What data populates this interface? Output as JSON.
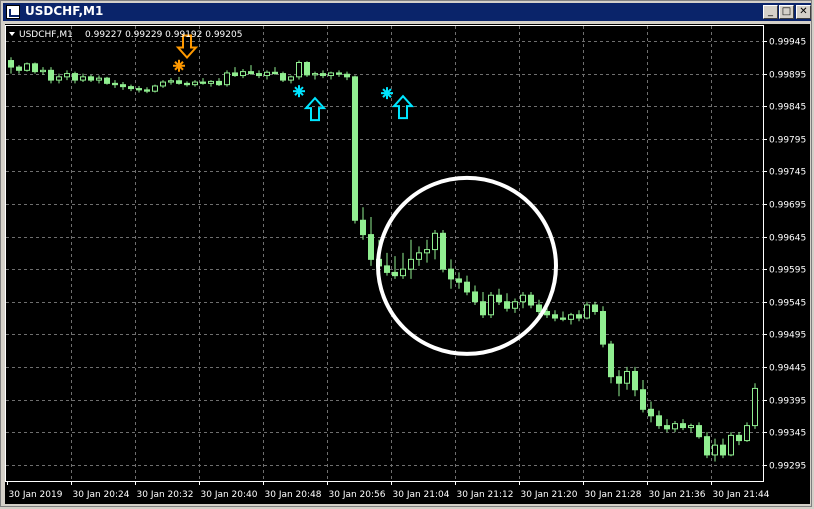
{
  "window": {
    "title": "USDCHF,M1",
    "minimize_glyph": "_",
    "maximize_glyph": "□",
    "close_glyph": "✕"
  },
  "chart_info": {
    "symbol": "USDCHF,M1",
    "ohlc": "0.99227 0.99229 0.99192 0.99205"
  },
  "colors": {
    "background": "#000000",
    "grid": "#6f6f6f",
    "candle": "#90ee90",
    "sell_signal": "#ff9900",
    "buy_signal": "#00e5ff",
    "circle": "#ffffff"
  },
  "chart_data": {
    "type": "candlestick",
    "title": "",
    "xlabel": "",
    "ylabel": "",
    "ylim": [
      0.9927,
      0.99968
    ],
    "grid": true,
    "y_ticks": [
      "0.99945",
      "0.99895",
      "0.99845",
      "0.99795",
      "0.99745",
      "0.99695",
      "0.99645",
      "0.99595",
      "0.99545",
      "0.99495",
      "0.99445",
      "0.99395",
      "0.99345",
      "0.99295"
    ],
    "x_ticks": [
      "30 Jan 2019",
      "30 Jan 20:24",
      "30 Jan 20:32",
      "30 Jan 20:40",
      "30 Jan 20:48",
      "30 Jan 20:56",
      "30 Jan 21:04",
      "30 Jan 21:12",
      "30 Jan 21:20",
      "30 Jan 21:28",
      "30 Jan 21:36",
      "30 Jan 21:44"
    ],
    "candles": [
      [
        0.99915,
        0.9992,
        0.99895,
        0.99905
      ],
      [
        0.99905,
        0.99908,
        0.99895,
        0.999
      ],
      [
        0.999,
        0.99912,
        0.99898,
        0.9991
      ],
      [
        0.9991,
        0.99912,
        0.99895,
        0.99898
      ],
      [
        0.99898,
        0.99905,
        0.99893,
        0.999
      ],
      [
        0.999,
        0.99905,
        0.9988,
        0.99885
      ],
      [
        0.99885,
        0.99895,
        0.9988,
        0.9989
      ],
      [
        0.9989,
        0.999,
        0.99885,
        0.99895
      ],
      [
        0.99895,
        0.99898,
        0.9988,
        0.99885
      ],
      [
        0.99885,
        0.99895,
        0.99882,
        0.9989
      ],
      [
        0.9989,
        0.99893,
        0.99882,
        0.99885
      ],
      [
        0.99885,
        0.99892,
        0.9988,
        0.99888
      ],
      [
        0.99888,
        0.9989,
        0.99878,
        0.9988
      ],
      [
        0.9988,
        0.99885,
        0.99873,
        0.99878
      ],
      [
        0.99878,
        0.99882,
        0.9987,
        0.99875
      ],
      [
        0.99875,
        0.99878,
        0.99868,
        0.99872
      ],
      [
        0.99872,
        0.99876,
        0.99866,
        0.9987
      ],
      [
        0.9987,
        0.99874,
        0.99865,
        0.99868
      ],
      [
        0.99868,
        0.99878,
        0.99866,
        0.99876
      ],
      [
        0.99876,
        0.99885,
        0.99873,
        0.99882
      ],
      [
        0.99882,
        0.99888,
        0.99878,
        0.99884
      ],
      [
        0.99884,
        0.9989,
        0.99878,
        0.9988
      ],
      [
        0.9988,
        0.99883,
        0.99875,
        0.99878
      ],
      [
        0.99878,
        0.99885,
        0.99875,
        0.99882
      ],
      [
        0.99882,
        0.99888,
        0.99878,
        0.9988
      ],
      [
        0.9988,
        0.99885,
        0.99875,
        0.99883
      ],
      [
        0.99883,
        0.99888,
        0.99876,
        0.99878
      ],
      [
        0.99878,
        0.999,
        0.99875,
        0.99896
      ],
      [
        0.99896,
        0.99905,
        0.9989,
        0.99892
      ],
      [
        0.99892,
        0.99902,
        0.99888,
        0.99898
      ],
      [
        0.99898,
        0.99908,
        0.99893,
        0.99895
      ],
      [
        0.99895,
        0.999,
        0.99888,
        0.99892
      ],
      [
        0.99892,
        0.999,
        0.99886,
        0.99897
      ],
      [
        0.99897,
        0.99905,
        0.99893,
        0.99895
      ],
      [
        0.99895,
        0.99898,
        0.99882,
        0.99885
      ],
      [
        0.99885,
        0.99892,
        0.9988,
        0.9989
      ],
      [
        0.9989,
        0.99915,
        0.99886,
        0.99912
      ],
      [
        0.99912,
        0.99914,
        0.9989,
        0.99893
      ],
      [
        0.99893,
        0.99898,
        0.99886,
        0.99895
      ],
      [
        0.99895,
        0.999,
        0.99888,
        0.99892
      ],
      [
        0.99892,
        0.99898,
        0.99886,
        0.99896
      ],
      [
        0.99896,
        0.999,
        0.9989,
        0.99894
      ],
      [
        0.99894,
        0.99898,
        0.99885,
        0.9989
      ],
      [
        0.9989,
        0.99892,
        0.99665,
        0.9967
      ],
      [
        0.9967,
        0.9969,
        0.9964,
        0.99648
      ],
      [
        0.99648,
        0.99675,
        0.996,
        0.9961
      ],
      [
        0.9961,
        0.9964,
        0.99595,
        0.996
      ],
      [
        0.996,
        0.9962,
        0.99585,
        0.9959
      ],
      [
        0.9959,
        0.99615,
        0.9958,
        0.99585
      ],
      [
        0.99585,
        0.9962,
        0.9958,
        0.99595
      ],
      [
        0.99595,
        0.9964,
        0.9958,
        0.9961
      ],
      [
        0.9961,
        0.9963,
        0.996,
        0.9962
      ],
      [
        0.9962,
        0.9964,
        0.99605,
        0.99625
      ],
      [
        0.99625,
        0.99655,
        0.9961,
        0.9965
      ],
      [
        0.9965,
        0.99655,
        0.9959,
        0.99595
      ],
      [
        0.99595,
        0.9961,
        0.99565,
        0.9958
      ],
      [
        0.9958,
        0.9959,
        0.99565,
        0.99575
      ],
      [
        0.99575,
        0.99585,
        0.99555,
        0.9956
      ],
      [
        0.9956,
        0.9957,
        0.9954,
        0.99545
      ],
      [
        0.99545,
        0.9956,
        0.9952,
        0.99525
      ],
      [
        0.99525,
        0.9956,
        0.9952,
        0.99555
      ],
      [
        0.99555,
        0.99565,
        0.9954,
        0.99545
      ],
      [
        0.99545,
        0.99558,
        0.9953,
        0.99535
      ],
      [
        0.99535,
        0.9955,
        0.99528,
        0.99545
      ],
      [
        0.99545,
        0.9956,
        0.99535,
        0.99555
      ],
      [
        0.99555,
        0.9956,
        0.99535,
        0.9954
      ],
      [
        0.9954,
        0.99548,
        0.99525,
        0.9953
      ],
      [
        0.9953,
        0.9954,
        0.9952,
        0.99525
      ],
      [
        0.99525,
        0.99532,
        0.99515,
        0.9952
      ],
      [
        0.9952,
        0.9953,
        0.99515,
        0.99518
      ],
      [
        0.99518,
        0.99528,
        0.9951,
        0.99525
      ],
      [
        0.99525,
        0.99532,
        0.99515,
        0.9952
      ],
      [
        0.9952,
        0.99545,
        0.99518,
        0.9954
      ],
      [
        0.9954,
        0.99545,
        0.99525,
        0.9953
      ],
      [
        0.9953,
        0.99538,
        0.99475,
        0.9948
      ],
      [
        0.9948,
        0.99485,
        0.9942,
        0.9943
      ],
      [
        0.9943,
        0.9944,
        0.994,
        0.9942
      ],
      [
        0.9942,
        0.99445,
        0.9941,
        0.99438
      ],
      [
        0.99438,
        0.99445,
        0.994,
        0.9941
      ],
      [
        0.9941,
        0.99425,
        0.99375,
        0.9938
      ],
      [
        0.9938,
        0.99392,
        0.9936,
        0.9937
      ],
      [
        0.9937,
        0.99378,
        0.9935,
        0.99355
      ],
      [
        0.99355,
        0.99365,
        0.99345,
        0.9935
      ],
      [
        0.9935,
        0.99362,
        0.99345,
        0.99358
      ],
      [
        0.99358,
        0.99365,
        0.99348,
        0.99352
      ],
      [
        0.99352,
        0.99358,
        0.99345,
        0.99355
      ],
      [
        0.99355,
        0.9936,
        0.99335,
        0.99338
      ],
      [
        0.99338,
        0.99345,
        0.99305,
        0.9931
      ],
      [
        0.9931,
        0.99335,
        0.993,
        0.99325
      ],
      [
        0.99325,
        0.99335,
        0.99305,
        0.9931
      ],
      [
        0.9931,
        0.99345,
        0.99308,
        0.9934
      ],
      [
        0.9934,
        0.99345,
        0.99325,
        0.99332
      ],
      [
        0.99332,
        0.9936,
        0.9933,
        0.99355
      ],
      [
        0.99355,
        0.9942,
        0.9935,
        0.99412
      ]
    ],
    "markers": [
      {
        "type": "star",
        "color": "sell_signal",
        "candle": 21,
        "price": 0.99907
      },
      {
        "type": "arrow-down",
        "color": "sell_signal",
        "candle": 22,
        "price": 0.99935
      },
      {
        "type": "star",
        "color": "buy_signal",
        "candle": 36,
        "price": 0.99868
      },
      {
        "type": "arrow-up",
        "color": "buy_signal",
        "candle": 38,
        "price": 0.99842
      },
      {
        "type": "star",
        "color": "buy_signal",
        "candle": 47,
        "price": 0.99865
      },
      {
        "type": "arrow-up",
        "color": "buy_signal",
        "candle": 49,
        "price": 0.99845
      }
    ],
    "annotation_circle": {
      "center_candle": 57,
      "center_price": 0.996,
      "radius_minutes": 11,
      "radius_price": 0.001
    }
  }
}
